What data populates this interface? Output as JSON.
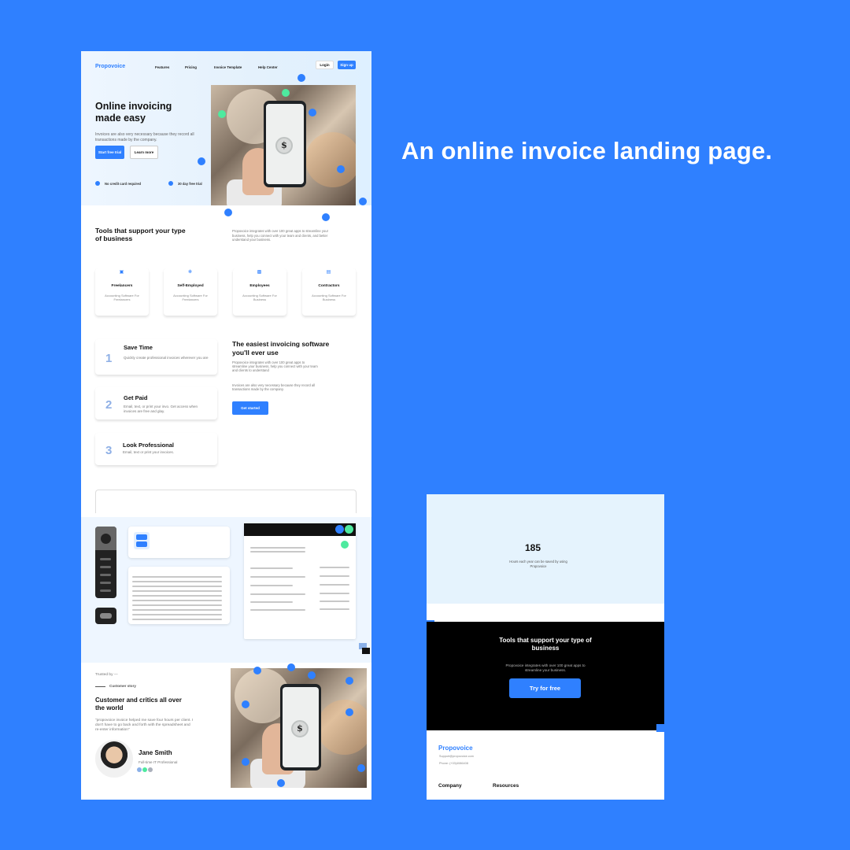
{
  "headline": "An online invoice landing page.",
  "landing": {
    "brand": "Propovoice",
    "nav": [
      "Features",
      "Pricing",
      "Invoice Template",
      "Help Center"
    ],
    "login": "Login",
    "signup": "Sign up",
    "hero": {
      "title": "Online invoicing made easy",
      "desc": "Invoices are also very necessary because they record all transactions made by the company.",
      "cta_primary": "Start free trial",
      "cta_secondary": "Learn more",
      "checks": [
        "No credit card required",
        "30 day free trial"
      ]
    },
    "tools": {
      "title": "Tools that support your type of business",
      "desc": "Propovoice integrates with over 100 great apps to streamline your business, help you connect with your team and clients, and better understand your business.",
      "cards": [
        {
          "title": "Freelancers",
          "desc": "Accounting Software For Freelancers",
          "icon": "trash-icon"
        },
        {
          "title": "Self-Employed",
          "desc": "Accounting Software For Freelancers",
          "icon": "gear-icon"
        },
        {
          "title": "Employees",
          "desc": "Accounting Software For Business",
          "icon": "square-icon"
        },
        {
          "title": "Contractors",
          "desc": "Accounting Software For Business",
          "icon": "briefcase-icon"
        }
      ]
    },
    "steps": [
      {
        "num": "1",
        "title": "Save Time",
        "desc": "Quickly create professional invoices wherever you are"
      },
      {
        "num": "2",
        "title": "Get Paid",
        "desc": "Email, text, or print your invo. Get access when invoices are free and glay."
      },
      {
        "num": "3",
        "title": "Look Professional",
        "desc": "Email, text or print your invoices."
      }
    ],
    "easiest": {
      "title": "The easiest invoicing software you'll ever use",
      "desc1": "Propovoice integrates with over 100 great apps to streamline your business, help you connect with your team and clients to understand",
      "desc2": "Invoices are also very necessary because they record all transactions made by the company.",
      "cta": "Get started"
    },
    "testimonial": {
      "trusted": "Trusted by —",
      "label": "Customer story",
      "title": "Customer and critics all over the world",
      "quote": "\"propovoice invoice helped me save four hours per client. I don't have to go back and forth with the spreadsheet and re-enter information\"",
      "name": "Jane Smith",
      "role": "Full-time IT Professional"
    }
  },
  "landing2": {
    "stat_number": "185",
    "stat_desc": "Hours each year can be saved by using Propovoice",
    "tools_title": "Tools that support your type of business",
    "tools_sub": "Propovoice integrates with over 100 great apps to streamline your business.",
    "cta": "Try for free",
    "brand": "Propovoice",
    "email": "Support@propovoice.com",
    "phone": "Phone: (+03)4086408",
    "footer_cols": [
      "Company",
      "Resources"
    ]
  },
  "colors": {
    "accent": "#2f80ff",
    "green": "#4eea9f",
    "background": "#2f80ff"
  }
}
